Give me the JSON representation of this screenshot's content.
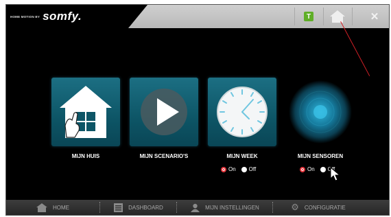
{
  "header": {
    "brand_sub": "HOME MOTION BY",
    "brand_logo": "somfy.",
    "t_button": "T",
    "close_icon": "✕"
  },
  "tiles": [
    {
      "label": "MIJN HUIS",
      "icon": "house-icon"
    },
    {
      "label": "MIJN SCENARIO'S",
      "icon": "play-icon"
    },
    {
      "label": "MIJN WEEK",
      "icon": "clock-icon",
      "on_label": "On",
      "off_label": "Off",
      "selected": "On"
    },
    {
      "label": "MIJN SENSOREN",
      "icon": "sensor-icon",
      "on_label": "On",
      "off_label": "Off",
      "selected": "On"
    }
  ],
  "footer": {
    "items": [
      {
        "label": "HOME",
        "icon": "home-icon"
      },
      {
        "label": "DASHBOARD",
        "icon": "dashboard-icon"
      },
      {
        "label": "MIJN INSTELLINGEN",
        "icon": "user-icon"
      },
      {
        "label": "CONFIGURATIE",
        "icon": "gear-icon"
      }
    ]
  },
  "colors": {
    "accent_teal": "#0d5566",
    "radio_red": "#e5333a",
    "badge_green": "#5fae27"
  }
}
